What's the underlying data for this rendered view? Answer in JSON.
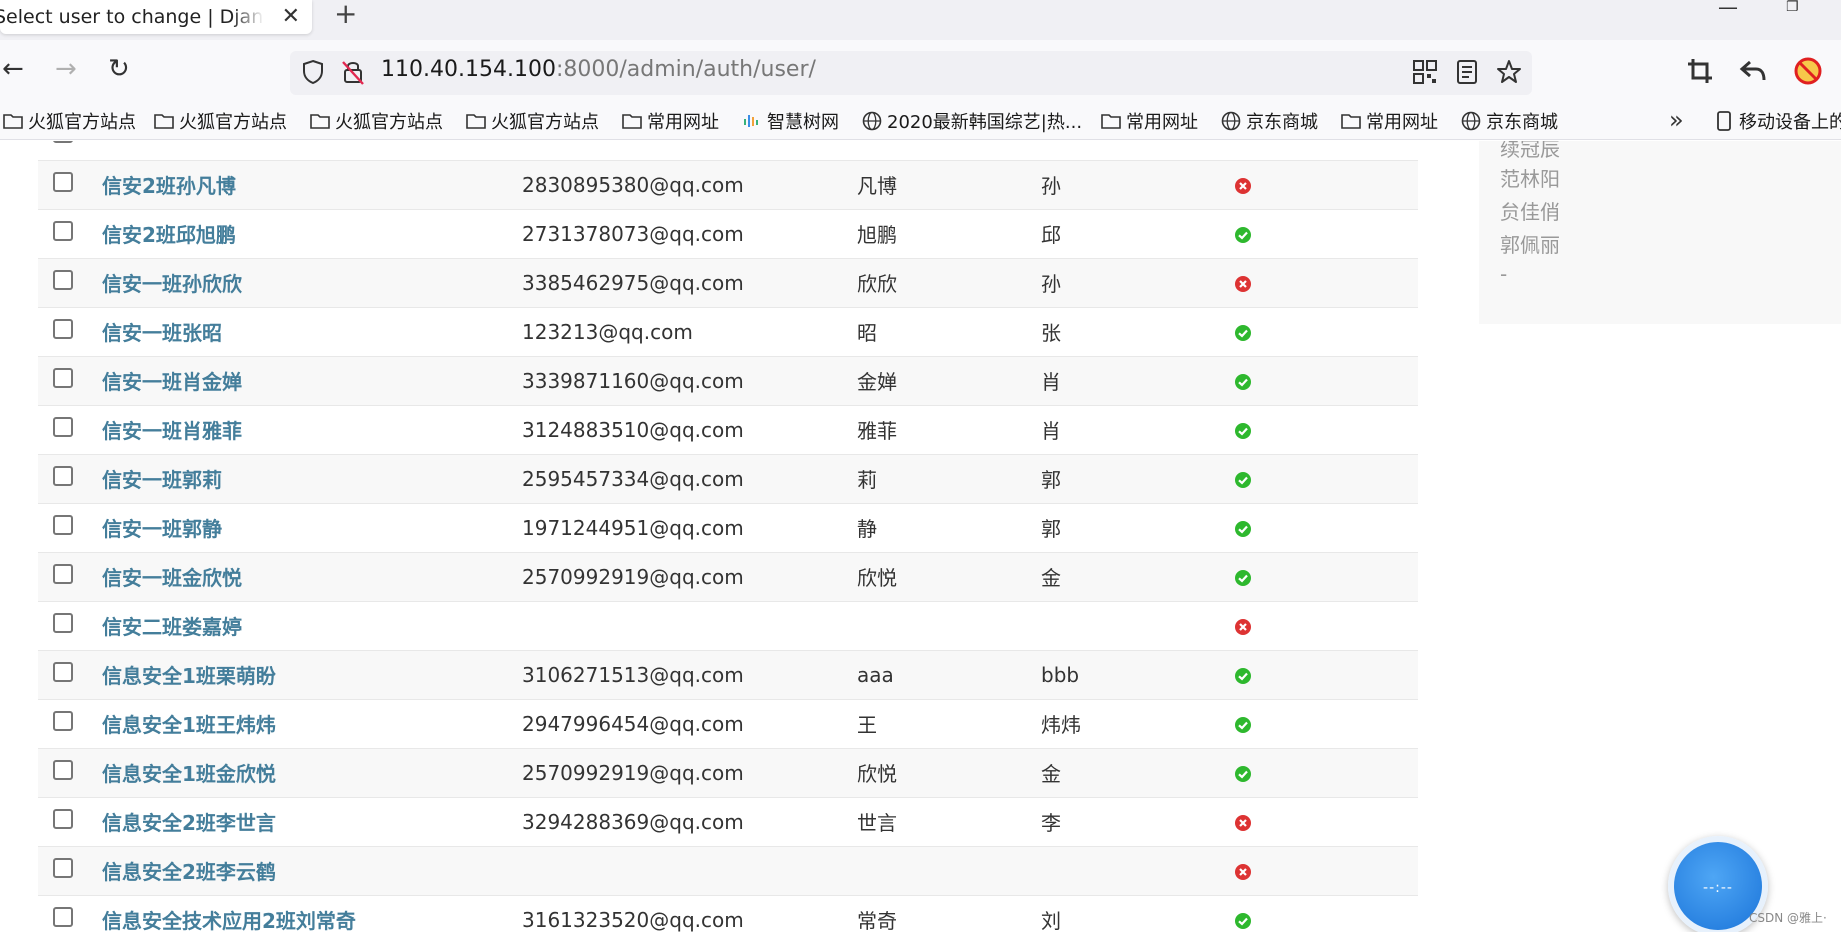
{
  "browser": {
    "tab_title": "Select user to change | Django site admin",
    "url_host": "110.40.154.100",
    "url_rest": ":8000/admin/auth/user/"
  },
  "bookmarks": [
    {
      "label": "火狐官方站点",
      "icon": "folder-icon"
    },
    {
      "label": "火狐官方站点",
      "icon": "folder-icon"
    },
    {
      "label": "火狐官方站点",
      "icon": "folder-icon"
    },
    {
      "label": "火狐官方站点",
      "icon": "folder-icon"
    },
    {
      "label": "常用网址",
      "icon": "folder-icon"
    },
    {
      "label": "智慧树网",
      "icon": "zhihuishu-icon"
    },
    {
      "label": "2020最新韩国综艺|热...",
      "icon": "globe-icon"
    },
    {
      "label": "常用网址",
      "icon": "folder-icon"
    },
    {
      "label": "京东商城",
      "icon": "globe-icon"
    },
    {
      "label": "常用网址",
      "icon": "folder-icon"
    },
    {
      "label": "京东商城",
      "icon": "globe-icon"
    },
    {
      "label": "移动设备上的",
      "icon": "mobile-icon"
    }
  ],
  "users": [
    {
      "username": "信安2班孙凡博",
      "email": "2830895380@qq.com",
      "first_name": "凡博",
      "last_name": "孙",
      "is_staff": false
    },
    {
      "username": "信安2班邱旭鹏",
      "email": "2731378073@qq.com",
      "first_name": "旭鹏",
      "last_name": "邱",
      "is_staff": true
    },
    {
      "username": "信安一班孙欣欣",
      "email": "3385462975@qq.com",
      "first_name": "欣欣",
      "last_name": "孙",
      "is_staff": false
    },
    {
      "username": "信安一班张昭",
      "email": "123213@qq.com",
      "first_name": "昭",
      "last_name": "张",
      "is_staff": true
    },
    {
      "username": "信安一班肖金婵",
      "email": "3339871160@qq.com",
      "first_name": "金婵",
      "last_name": "肖",
      "is_staff": true
    },
    {
      "username": "信安一班肖雅菲",
      "email": "3124883510@qq.com",
      "first_name": "雅菲",
      "last_name": "肖",
      "is_staff": true
    },
    {
      "username": "信安一班郭莉",
      "email": "2595457334@qq.com",
      "first_name": "莉",
      "last_name": "郭",
      "is_staff": true
    },
    {
      "username": "信安一班郭静",
      "email": "1971244951@qq.com",
      "first_name": "静",
      "last_name": "郭",
      "is_staff": true
    },
    {
      "username": "信安一班金欣悦",
      "email": "2570992919@qq.com",
      "first_name": "欣悦",
      "last_name": "金",
      "is_staff": true
    },
    {
      "username": "信安二班娄嘉婷",
      "email": "",
      "first_name": "",
      "last_name": "",
      "is_staff": false
    },
    {
      "username": "信息安全1班栗萌盼",
      "email": "3106271513@qq.com",
      "first_name": "aaa",
      "last_name": "bbb",
      "is_staff": true
    },
    {
      "username": "信息安全1班王炜炜",
      "email": "2947996454@qq.com",
      "first_name": "王",
      "last_name": "炜炜",
      "is_staff": true
    },
    {
      "username": "信息安全1班金欣悦",
      "email": "2570992919@qq.com",
      "first_name": "欣悦",
      "last_name": "金",
      "is_staff": true
    },
    {
      "username": "信息安全2班李世言",
      "email": "3294288369@qq.com",
      "first_name": "世言",
      "last_name": "李",
      "is_staff": false
    },
    {
      "username": "信息安全2班李云鹤",
      "email": "",
      "first_name": "",
      "last_name": "",
      "is_staff": false
    },
    {
      "username": "信息安全技术应用2班刘常奇",
      "email": "3161323520@qq.com",
      "first_name": "常奇",
      "last_name": "刘",
      "is_staff": true
    }
  ],
  "filter": {
    "items": [
      "续冠辰",
      "范林阳",
      "贠佳俏",
      "郭佩丽",
      "-"
    ]
  },
  "float_widget": {
    "text": "--:--"
  },
  "watermark": "CSDN @雅上·",
  "colors": {
    "link": "#447e9b",
    "yes": "#2eb82e",
    "no": "#dd3333"
  }
}
